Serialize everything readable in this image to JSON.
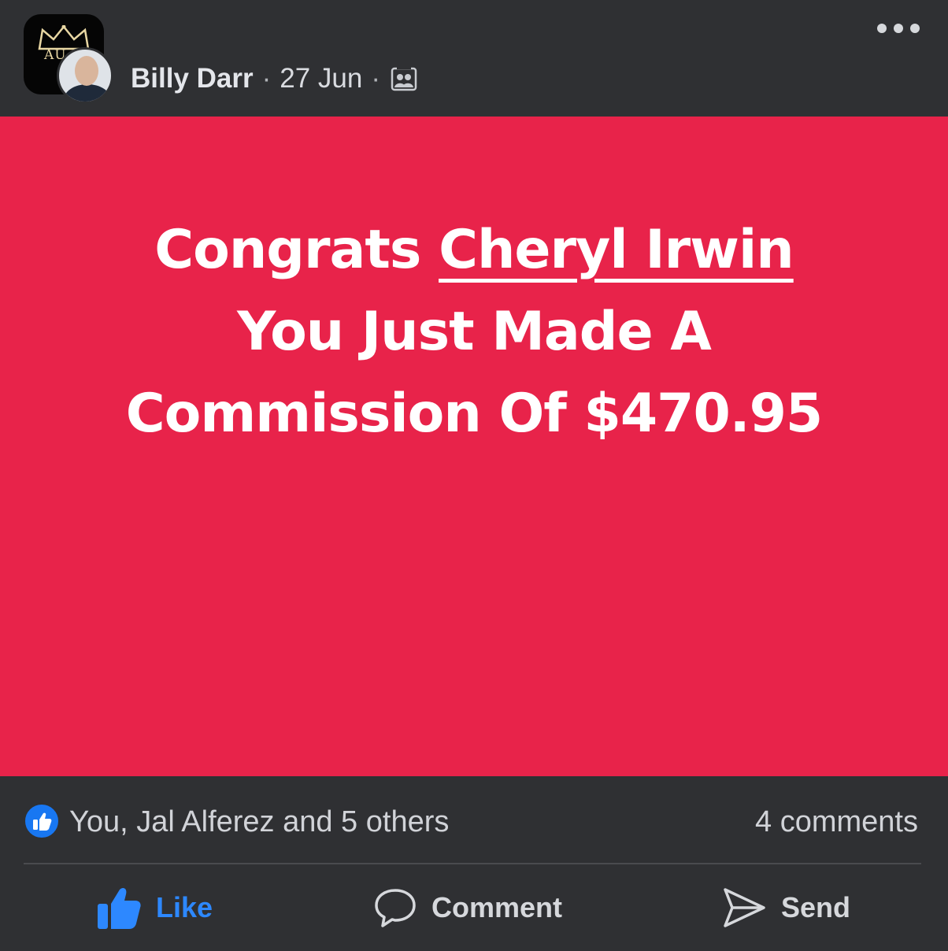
{
  "header": {
    "group_avatar": {
      "icon": "crown-icon",
      "text": "AU"
    },
    "author": "Billy Darr",
    "separator": "·",
    "date": "27 Jun",
    "audience_icon": "group-audience-icon",
    "more_icon": "more-options-icon"
  },
  "post": {
    "background_color": "#e8234a",
    "text_color": "#ffffff",
    "line1_prefix": "Congrats",
    "tagged_name": "Cheryl Irwin",
    "line2": "You Just Made A",
    "line3": "Commission Of $470.95"
  },
  "reactions": {
    "icon": "like-reaction-icon",
    "summary": "You, Jal Alferez and 5 others",
    "comments": "4 comments"
  },
  "actions": {
    "like_label": "Like",
    "comment_label": "Comment",
    "send_label": "Send",
    "like_active": true,
    "like_color": "#2d88ff"
  }
}
